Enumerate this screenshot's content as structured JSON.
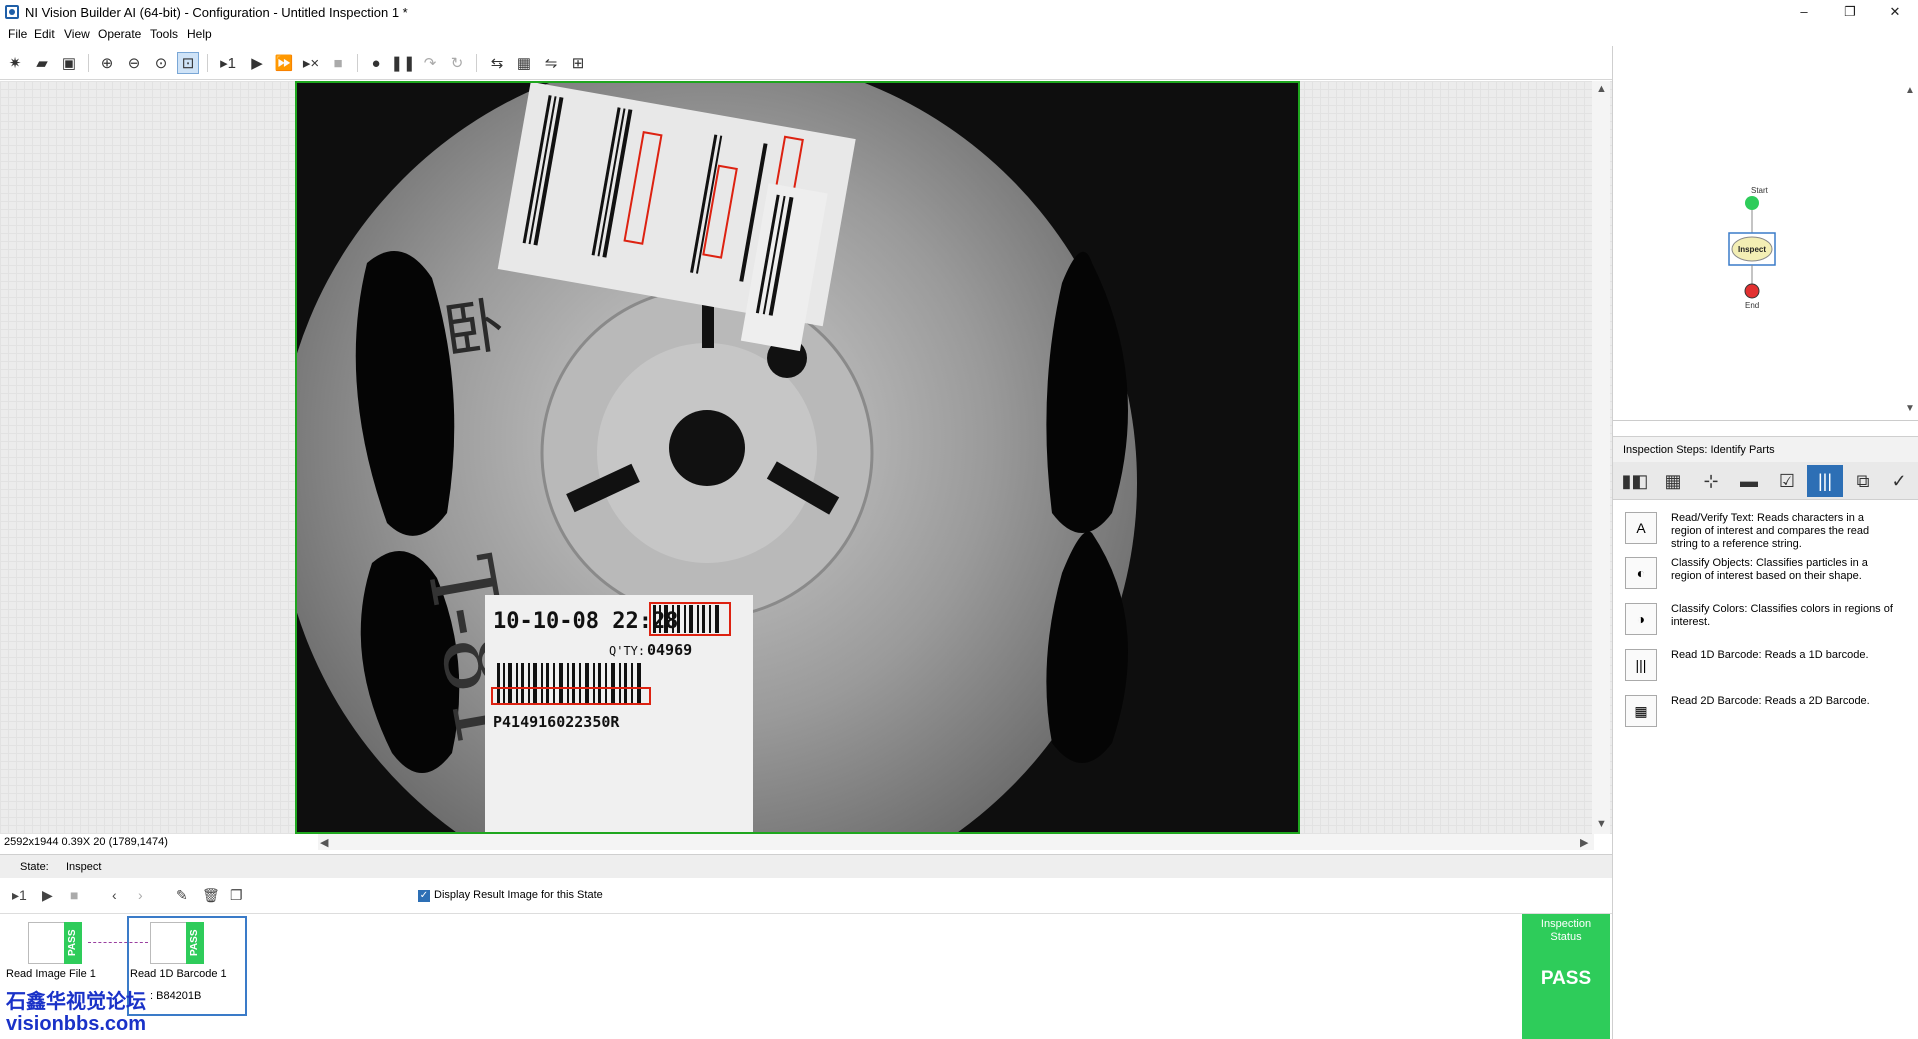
{
  "window": {
    "title": "NI Vision Builder AI (64-bit) - Configuration - Untitled Inspection 1 *",
    "minimize": "–",
    "maximize": "❐",
    "close": "✕"
  },
  "menu": [
    "File",
    "Edit",
    "View",
    "Operate",
    "Tools",
    "Help"
  ],
  "toolbar": {
    "icons": [
      "new-icon",
      "open-icon",
      "save-icon",
      "zoom-in-icon",
      "zoom-out-icon",
      "zoom-1to1-icon",
      "zoom-fit-icon",
      "run-once-icon",
      "run-icon",
      "run-continuous-icon",
      "run-stop-icon",
      "stop-icon",
      "breakpoint-icon",
      "pause-icon",
      "step-icon",
      "loop-icon",
      "tool-a-icon",
      "tool-b-icon",
      "tool-c-icon",
      "tool-d-icon"
    ],
    "help": "?"
  },
  "image": {
    "status": "2592x1944 0.39X 20    (1789,1474)",
    "label_bottom_date": "10-10-08 22:28",
    "label_bottom_qty_label": "Q'TY:",
    "label_bottom_qty": "04969",
    "label_bottom_code": "P414916022350R"
  },
  "state": {
    "label": "State:",
    "value": "Inspect"
  },
  "stepbar": {
    "display_result": "Display Result Image for this State"
  },
  "steps": [
    {
      "label": "Read Image File 1",
      "status": "PASS"
    },
    {
      "label": "Read 1D Barcode 1",
      "status": "PASS",
      "result": ": B84201B"
    }
  ],
  "inspection_status": {
    "title_line1": "Inspection",
    "title_line2": "Status",
    "value": "PASS"
  },
  "flow": {
    "start": "Start",
    "state": "Inspect",
    "end": "End"
  },
  "right_panel": {
    "header": "Inspection Steps: Identify Parts",
    "items": [
      {
        "name": "Read/Verify Text:",
        "desc": "Reads characters in a region of interest and compares the read string to a reference string."
      },
      {
        "name": "Classify Objects:",
        "desc": "Classifies particles in a region of interest based on their shape."
      },
      {
        "name": "Classify Colors:",
        "desc": "Classifies colors in regions of interest."
      },
      {
        "name": "Read 1D Barcode:",
        "desc": "Reads a 1D barcode."
      },
      {
        "name": "Read 2D Barcode:",
        "desc": "Reads a 2D Barcode."
      }
    ]
  },
  "watermark": {
    "line1": "石鑫华视觉论坛",
    "line2": "visionbbs.com"
  },
  "colors": {
    "pass": "#2ecc5a",
    "selection": "#2d6fb5",
    "roi": "#1ea61e"
  }
}
